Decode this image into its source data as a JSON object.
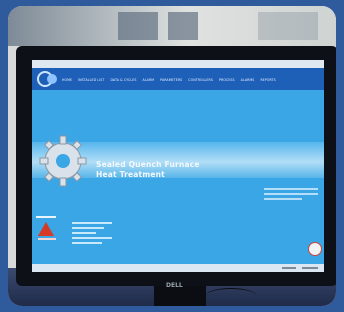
{
  "scene": {
    "description_role": "photo of monitor showing furnace control software",
    "monitor_brand": "DELL"
  },
  "app": {
    "window_title": "",
    "menu": [
      "HOME",
      "INSTALLED LIST",
      "DATA & CYCLES",
      "ALARM",
      "PARAMETERS",
      "CONTROLLERS",
      "PROCESS",
      "ALARMS",
      "REPORTS"
    ],
    "headline_line1": "Sealed Quench Furnace",
    "headline_line2": "Heat Treatment"
  },
  "colors": {
    "screen_bg": "#3aa6e6",
    "menu_band": "#1e5fb8",
    "brand_red": "#d43a26"
  },
  "icons": {
    "logo": "company-logo",
    "gear": "gear-icon",
    "seal": "quality-seal-icon",
    "brand_mark": "triangle-logo-icon"
  }
}
